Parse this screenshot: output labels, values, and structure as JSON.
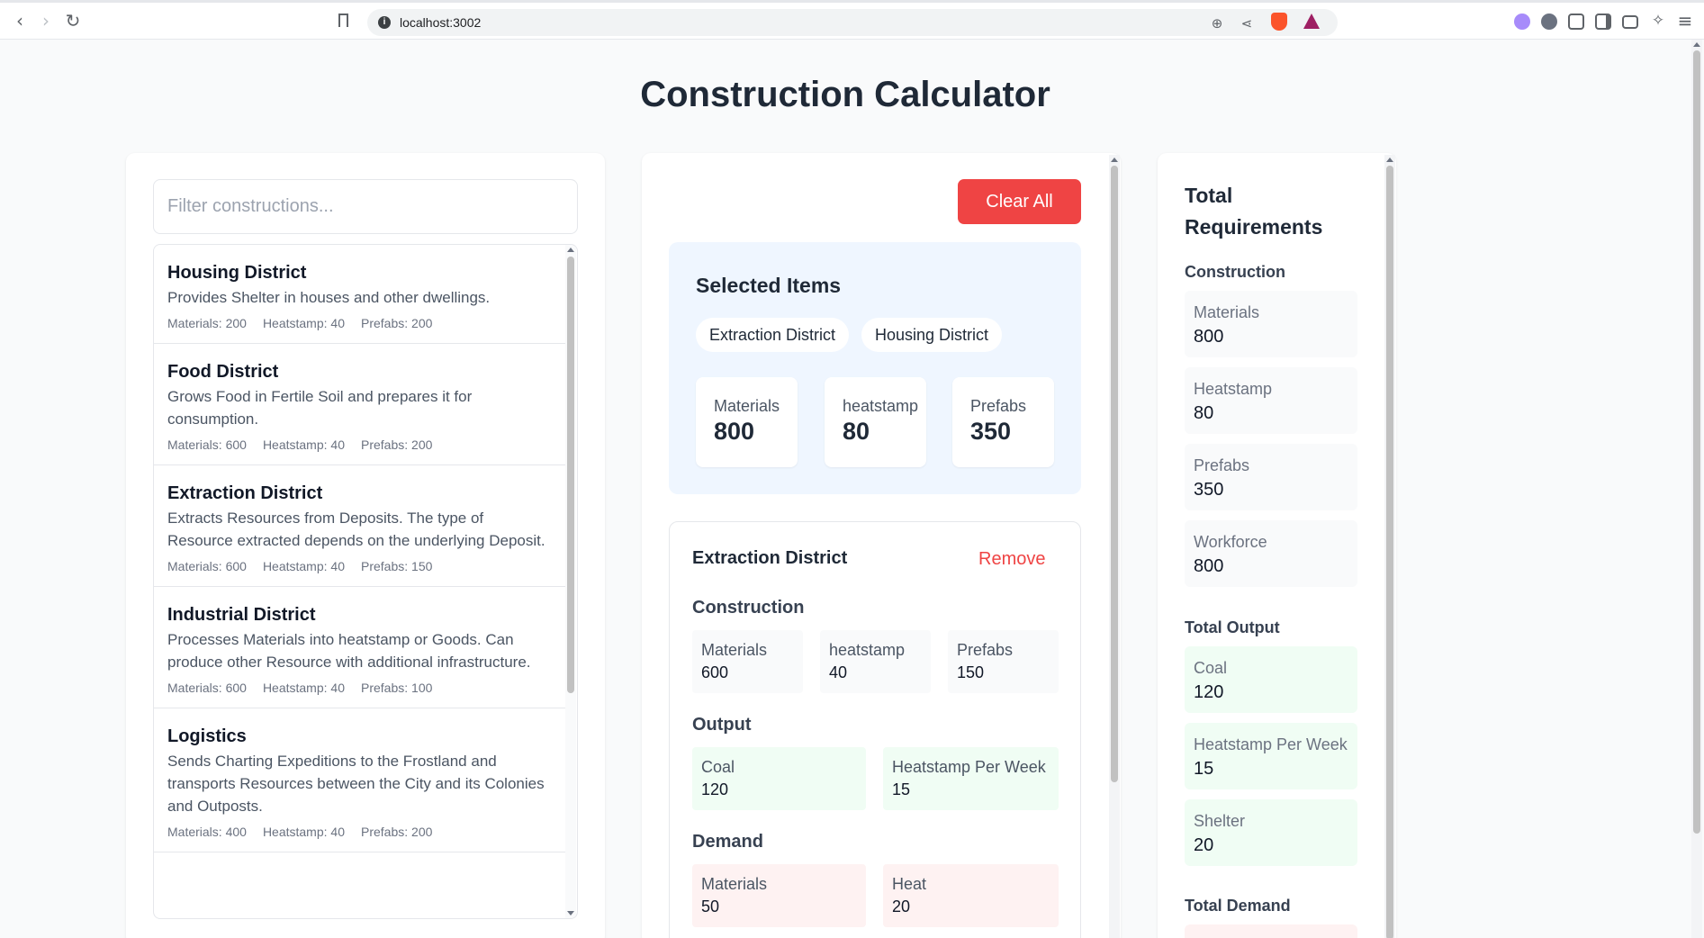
{
  "browser": {
    "url": "localhost:3002"
  },
  "page": {
    "title": "Construction Calculator"
  },
  "filter": {
    "placeholder": "Filter constructions..."
  },
  "constructions": [
    {
      "name": "Housing District",
      "desc": "Provides Shelter in houses and other dwellings.",
      "materials": "Materials: 200",
      "heatstamp": "Heatstamp: 40",
      "prefabs": "Prefabs: 200"
    },
    {
      "name": "Food District",
      "desc": "Grows Food in Fertile Soil and prepares it for consumption.",
      "materials": "Materials: 600",
      "heatstamp": "Heatstamp: 40",
      "prefabs": "Prefabs: 200"
    },
    {
      "name": "Extraction District",
      "desc": "Extracts Resources from Deposits. The type of Resource extracted depends on the underlying Deposit.",
      "materials": "Materials: 600",
      "heatstamp": "Heatstamp: 40",
      "prefabs": "Prefabs: 150"
    },
    {
      "name": "Industrial District",
      "desc": "Processes Materials into heatstamp or Goods. Can produce other Resource with additional infrastructure.",
      "materials": "Materials: 600",
      "heatstamp": "Heatstamp: 40",
      "prefabs": "Prefabs: 100"
    },
    {
      "name": "Logistics",
      "desc": "Sends Charting Expeditions to the Frostland and transports Resources between the City and its Colonies and Outposts.",
      "materials": "Materials: 400",
      "heatstamp": "Heatstamp: 40",
      "prefabs": "Prefabs: 200"
    }
  ],
  "actions": {
    "clear_all": "Clear All"
  },
  "selected": {
    "title": "Selected Items",
    "chips": [
      "Extraction District",
      "Housing District"
    ],
    "summary": [
      {
        "label": "Materials",
        "value": "800"
      },
      {
        "label": "heatstamp",
        "value": "80"
      },
      {
        "label": "Prefabs",
        "value": "350"
      }
    ]
  },
  "detail": {
    "title": "Extraction District",
    "remove_label": "Remove",
    "construction_title": "Construction",
    "construction": [
      {
        "label": "Materials",
        "value": "600"
      },
      {
        "label": "heatstamp",
        "value": "40"
      },
      {
        "label": "Prefabs",
        "value": "150"
      }
    ],
    "output_title": "Output",
    "output": [
      {
        "label": "Coal",
        "value": "120"
      },
      {
        "label": "Heatstamp Per Week",
        "value": "15"
      }
    ],
    "demand_title": "Demand",
    "demand": [
      {
        "label": "Materials",
        "value": "50"
      },
      {
        "label": "Heat",
        "value": "20"
      }
    ]
  },
  "totals": {
    "title": "Total Requirements",
    "construction_title": "Construction",
    "construction": [
      {
        "label": "Materials",
        "value": "800"
      },
      {
        "label": "Heatstamp",
        "value": "80"
      },
      {
        "label": "Prefabs",
        "value": "350"
      },
      {
        "label": "Workforce",
        "value": "800"
      }
    ],
    "output_title": "Total Output",
    "output": [
      {
        "label": "Coal",
        "value": "120"
      },
      {
        "label": "Heatstamp Per Week",
        "value": "15"
      },
      {
        "label": "Shelter",
        "value": "20"
      }
    ],
    "demand_title": "Total Demand"
  },
  "colors": {
    "accent_red": "#ef4444",
    "selected_bg": "#eff6ff",
    "output_bg": "#f0fdf4",
    "demand_bg": "#fef2f2"
  }
}
